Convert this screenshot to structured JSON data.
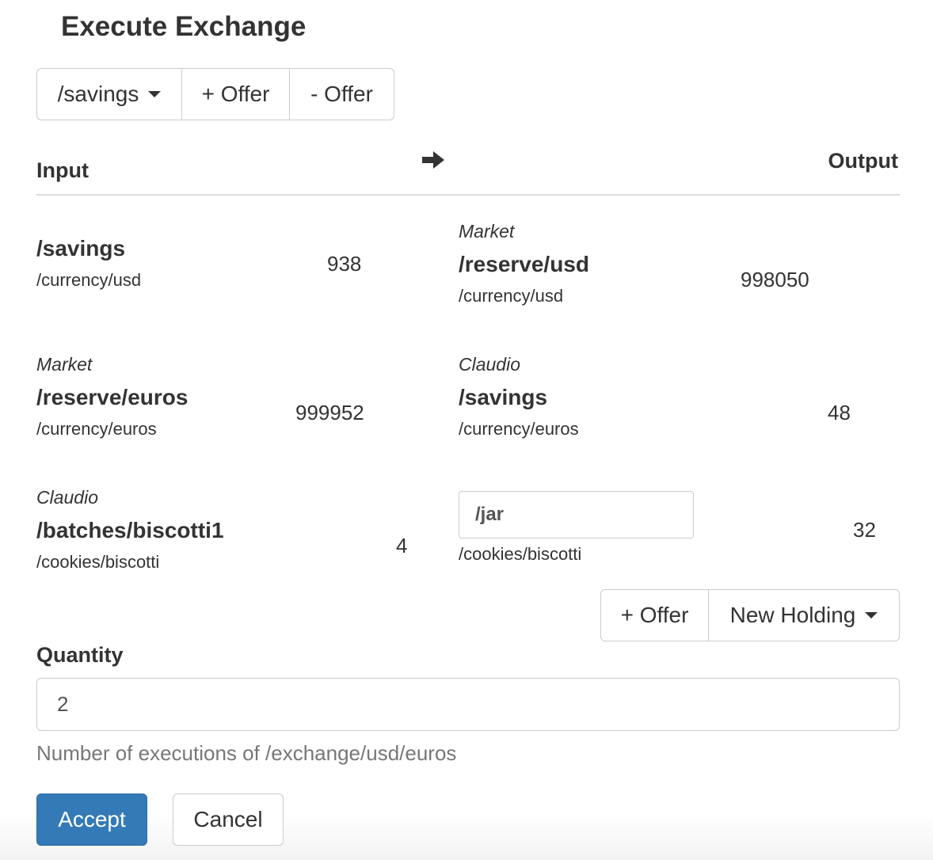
{
  "dialog": {
    "title": "Execute Exchange"
  },
  "toolbar": {
    "holding_select": "/savings",
    "add_offer": "+ Offer",
    "remove_offer": "- Offer"
  },
  "columns": {
    "input": "Input",
    "output": "Output",
    "arrow_icon": "arrow-right-icon"
  },
  "inputs": [
    {
      "owner": "",
      "path": "/savings",
      "asset": "/currency/usd",
      "amount": "938"
    },
    {
      "owner": "Market",
      "path": "/reserve/euros",
      "asset": "/currency/euros",
      "amount": "999952"
    },
    {
      "owner": "Claudio",
      "path": "/batches/biscotti1",
      "asset": "/cookies/biscotti",
      "amount": "4"
    }
  ],
  "outputs": [
    {
      "owner": "Market",
      "path": "/reserve/usd",
      "asset": "/currency/usd",
      "amount": "998050"
    },
    {
      "owner": "Claudio",
      "path": "/savings",
      "asset": "/currency/euros",
      "amount": "48"
    },
    {
      "holding_value": "/jar",
      "asset": "/cookies/biscotti",
      "amount": "32"
    }
  ],
  "output_actions": {
    "add_offer": "+ Offer",
    "new_holding": "New Holding"
  },
  "quantity": {
    "label": "Quantity",
    "value": "2",
    "help": "Number of executions of /exchange/usd/euros"
  },
  "actions": {
    "accept": "Accept",
    "cancel": "Cancel"
  },
  "colors": {
    "primary": "#337ab7",
    "border": "#cccccc",
    "muted": "#777777"
  }
}
